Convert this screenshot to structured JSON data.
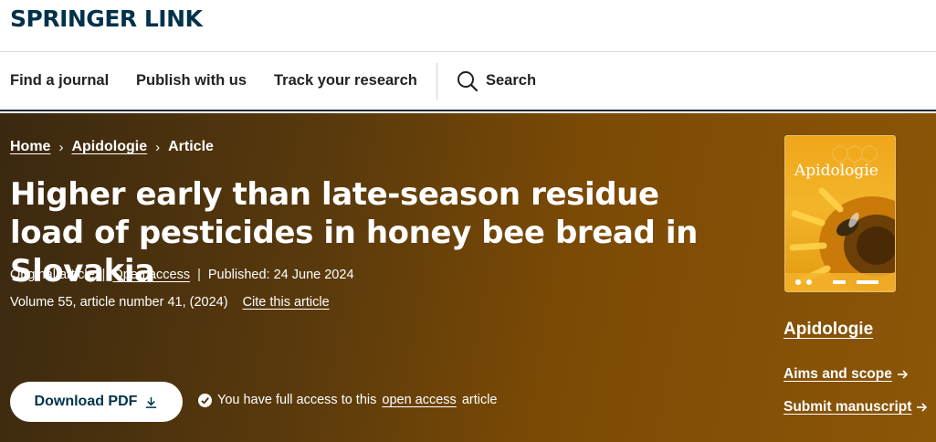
{
  "header": {
    "logo": "SPRINGER LINK"
  },
  "nav": {
    "items": [
      {
        "label": "Find a journal"
      },
      {
        "label": "Publish with us"
      },
      {
        "label": "Track your research"
      }
    ],
    "search_label": "Search"
  },
  "breadcrumb": {
    "items": [
      "Home",
      "Apidologie",
      "Article"
    ],
    "separator": "›"
  },
  "article": {
    "title": "Higher early than late-season residue load of pesticides in honey bee bread in Slovakia",
    "type": "Original article",
    "access": "Open access",
    "published": "Published: 24 June 2024",
    "volume": "Volume 55, article number 41, (2024)",
    "cite_label": "Cite this article"
  },
  "actions": {
    "download_label": "Download PDF",
    "access_prefix": "You have full access to this",
    "access_link": "open access",
    "access_suffix": "article"
  },
  "journal": {
    "cover_title": "Apidologie",
    "name": "Apidologie",
    "links": [
      {
        "label": "Aims and scope"
      },
      {
        "label": "Submit manuscript"
      }
    ]
  },
  "colors": {
    "brand": "#01324b",
    "hero_dark": "#3a2810",
    "hero_light": "#8c5607",
    "cover_orange": "#f0a61a"
  },
  "icons": {
    "search": "search-icon",
    "download": "download-icon",
    "check": "check-circle-icon",
    "arrow": "arrow-right-icon"
  }
}
